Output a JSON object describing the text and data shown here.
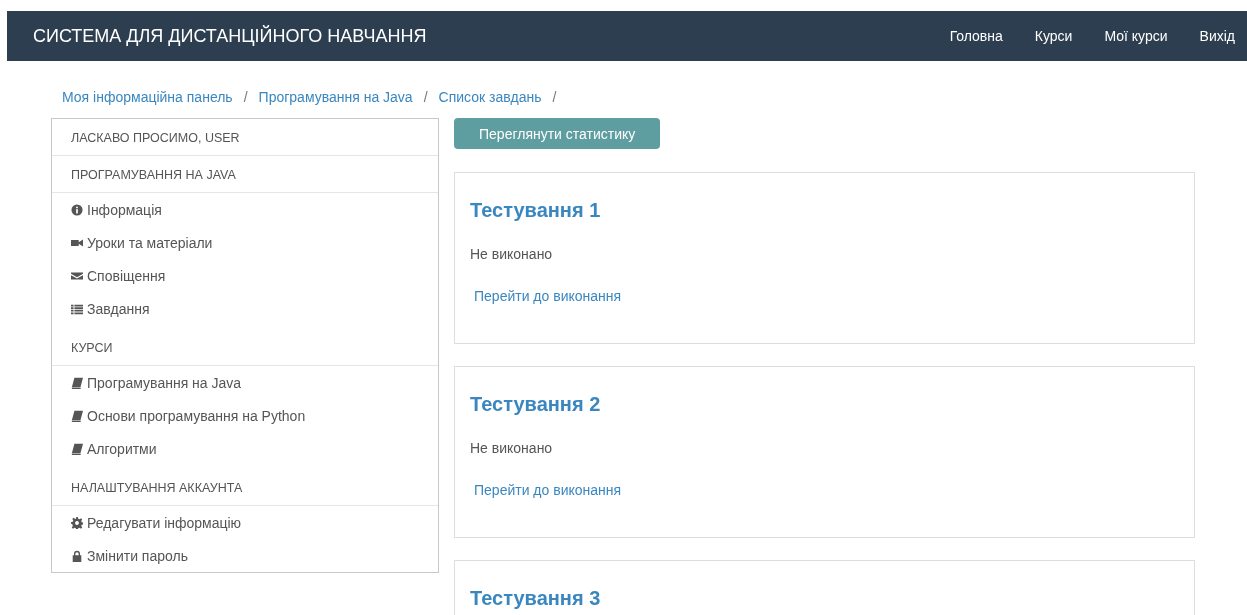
{
  "navbar": {
    "brand": "СИСТЕМА ДЛЯ ДИСТАНЦІЙНОГО НАВЧАННЯ",
    "links": [
      "Головна",
      "Курси",
      "Мої курси",
      "Вихід"
    ]
  },
  "breadcrumb": [
    {
      "label": "Моя інформаційна панель",
      "separator": "/"
    },
    {
      "label": "Програмування на Java",
      "separator": "/"
    },
    {
      "label": "Список завдань",
      "separator": "/"
    }
  ],
  "sidebar": {
    "sections": [
      {
        "title": "ЛАСКАВО ПРОСИМО, USER"
      },
      {
        "title": "ПРОГРАМУВАННЯ НА JAVA",
        "items": [
          "Інформація",
          "Уроки та матеріали",
          "Сповіщення",
          "Завдання"
        ]
      },
      {
        "title": "КУРСИ",
        "items": [
          "Програмування на Java",
          "Основи програмування на Python",
          "Алгоритми"
        ]
      },
      {
        "title": "НАЛАШТУВАННЯ АККАУНТА",
        "items": [
          "Редагувати інформацію",
          "Змінити пароль"
        ]
      }
    ]
  },
  "stats_button": "Переглянути статистику",
  "tests": [
    {
      "title": "Тестування 1",
      "status": "Не виконано",
      "link": "Перейти до виконання"
    },
    {
      "title": "Тестування 2",
      "status": "Не виконано",
      "link": "Перейти до виконання"
    },
    {
      "title": "Тестування 3"
    }
  ]
}
